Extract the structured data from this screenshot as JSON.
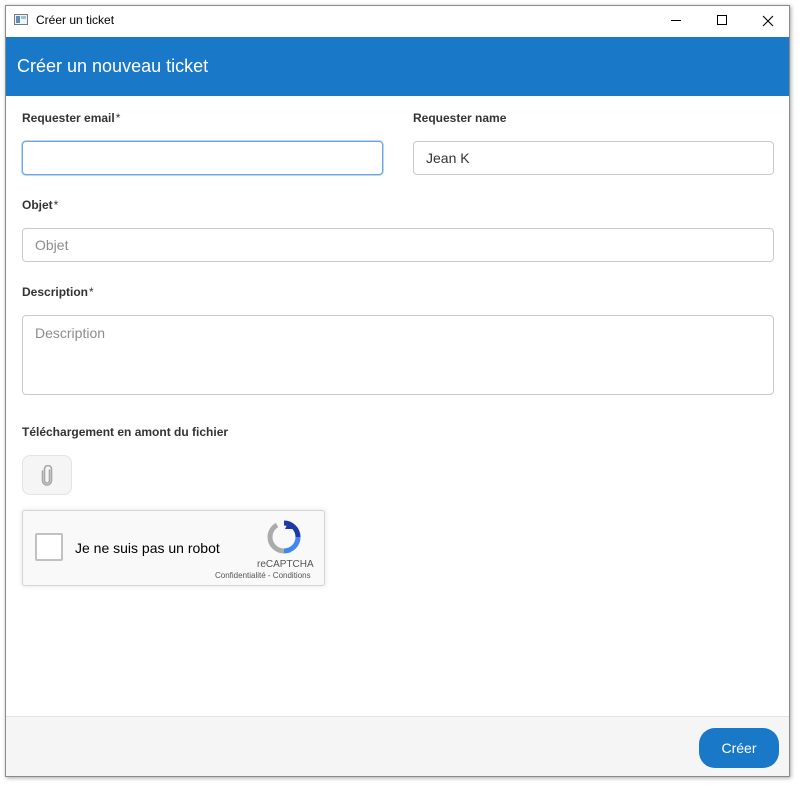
{
  "window": {
    "title": "Créer un ticket"
  },
  "header": {
    "title": "Créer un nouveau ticket"
  },
  "form": {
    "requester_email": {
      "label": "Requester email",
      "required_mark": "*",
      "value": "",
      "placeholder": ""
    },
    "requester_name": {
      "label": "Requester name",
      "value": "Jean K"
    },
    "subject": {
      "label": "Objet",
      "required_mark": "*",
      "placeholder": "Objet"
    },
    "description": {
      "label": "Description",
      "required_mark": "*",
      "placeholder": "Description"
    },
    "upload": {
      "label": "Téléchargement en amont du fichier"
    }
  },
  "captcha": {
    "label": "Je ne suis pas un robot",
    "brand": "reCAPTCHA",
    "links": "Confidentialité - Conditions"
  },
  "footer": {
    "create_label": "Créer"
  },
  "colors": {
    "accent": "#1a78c8",
    "footer_bg": "#f5f5f5"
  }
}
